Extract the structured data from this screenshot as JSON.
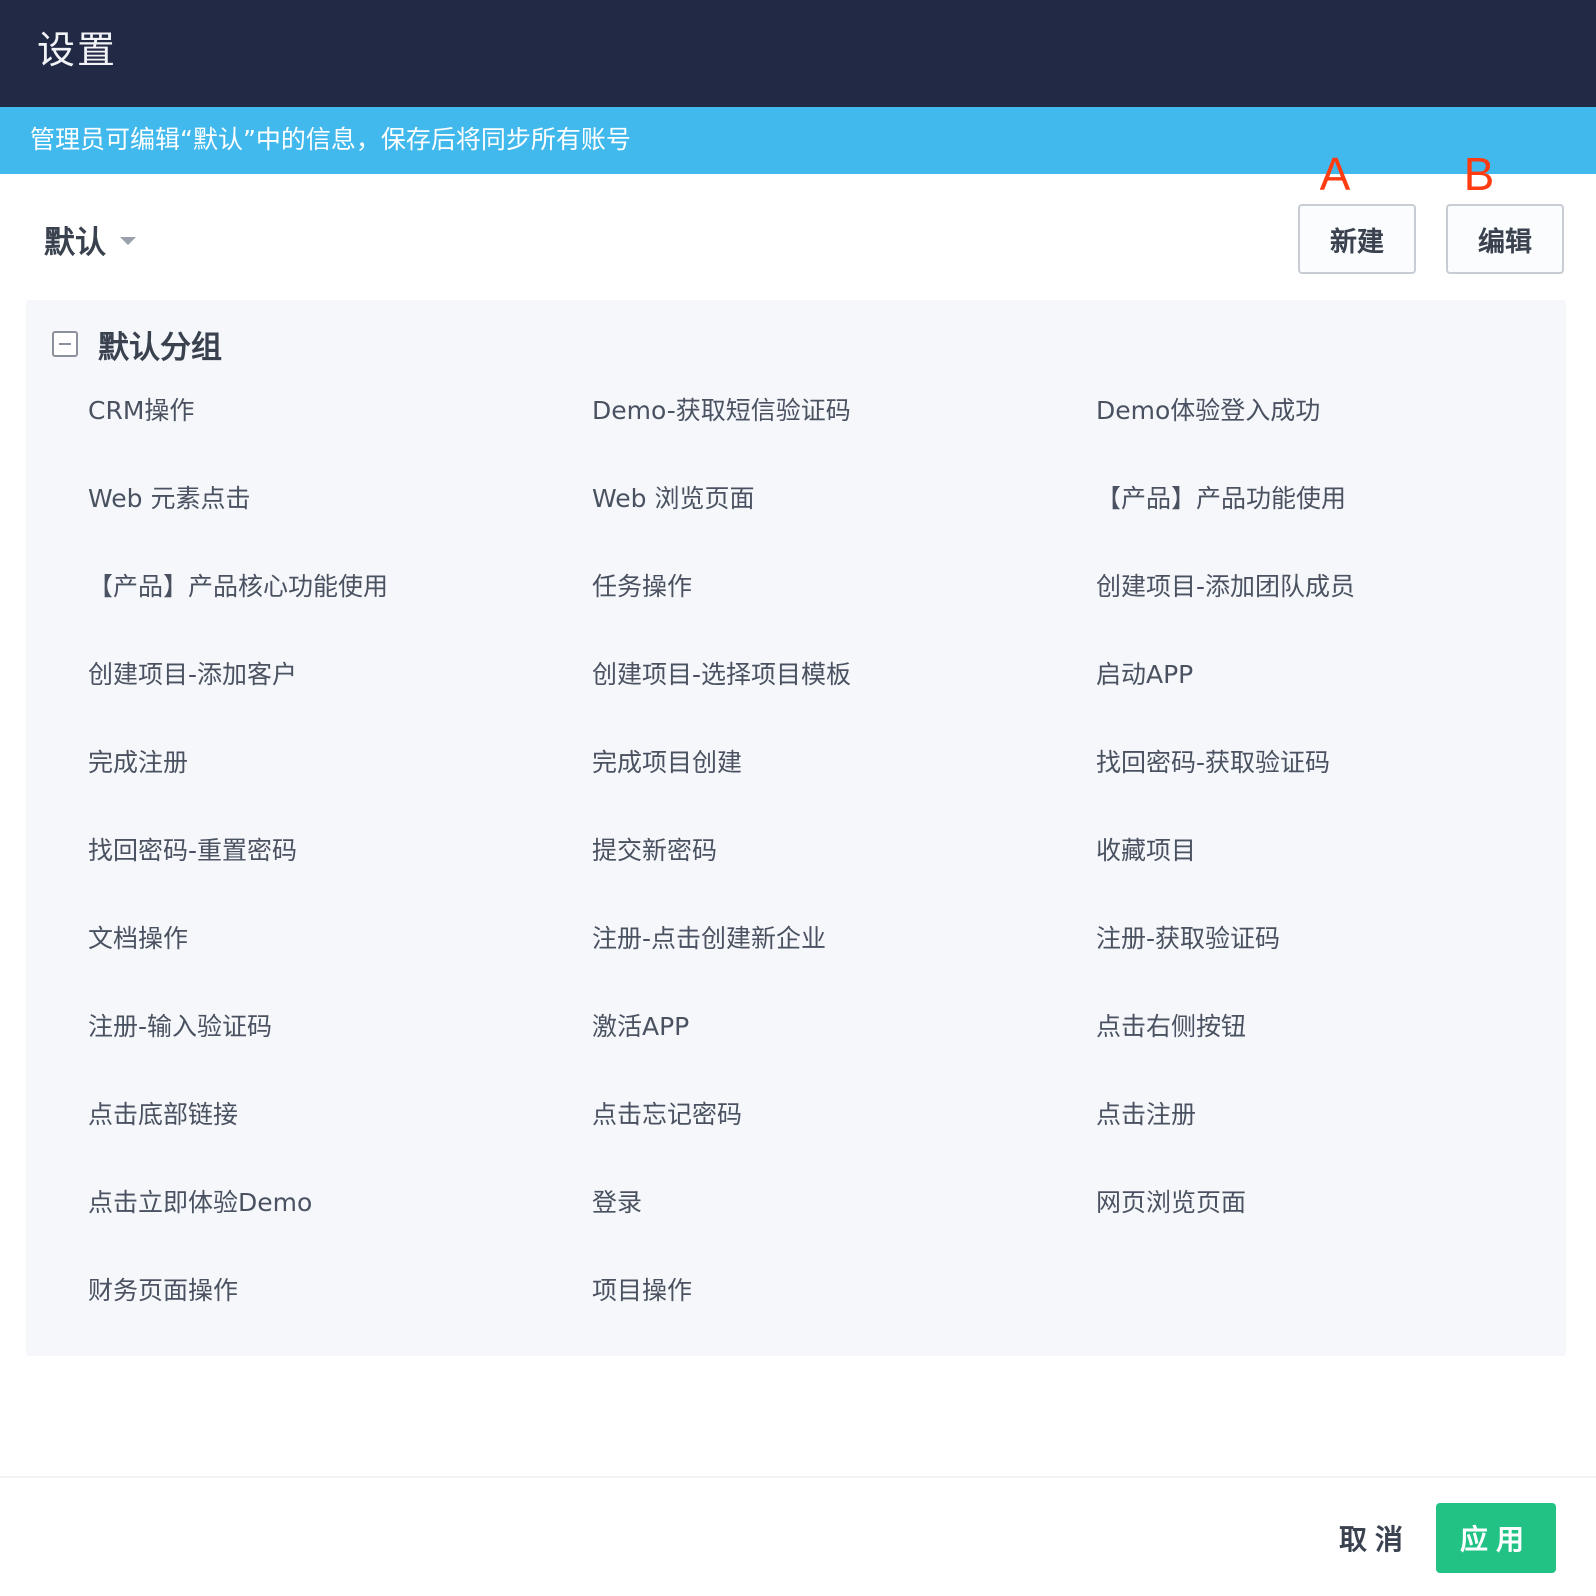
{
  "dialog": {
    "title": "设置",
    "notice": "管理员可编辑“默认”中的信息，保存后将同步所有账号"
  },
  "toolbar": {
    "preset_value": "默认",
    "preset_caret_icon": "caret-down-icon",
    "new_marker": "A",
    "new_label": "新建",
    "edit_marker": "B",
    "edit_label": "编辑"
  },
  "group": {
    "collapse_icon": "minus-square-icon",
    "title": "默认分组",
    "items": [
      "CRM操作",
      "Demo-获取短信验证码",
      "Demo体验登入成功",
      "Web 元素点击",
      "Web 浏览页面",
      "【产品】产品功能使用",
      "【产品】产品核心功能使用",
      "任务操作",
      "创建项目-添加团队成员",
      "创建项目-添加客户",
      "创建项目-选择项目模板",
      "启动APP",
      "完成注册",
      "完成项目创建",
      "找回密码-获取验证码",
      "找回密码-重置密码",
      "提交新密码",
      "收藏项目",
      "文档操作",
      "注册-点击创建新企业",
      "注册-获取验证码",
      "注册-输入验证码",
      "激活APP",
      "点击右侧按钮",
      "点击底部链接",
      "点击忘记密码",
      "点击注册",
      "点击立即体验Demo",
      "登录",
      "网页浏览页面",
      "财务页面操作",
      "项目操作"
    ]
  },
  "footer": {
    "cancel_label": "取消",
    "apply_label": "应用"
  },
  "colors": {
    "titlebar": "#222944",
    "notice_bar": "#41b9ec",
    "marker": "#ff3b12",
    "apply_button": "#22c184",
    "panel": "#f5f7fa"
  }
}
